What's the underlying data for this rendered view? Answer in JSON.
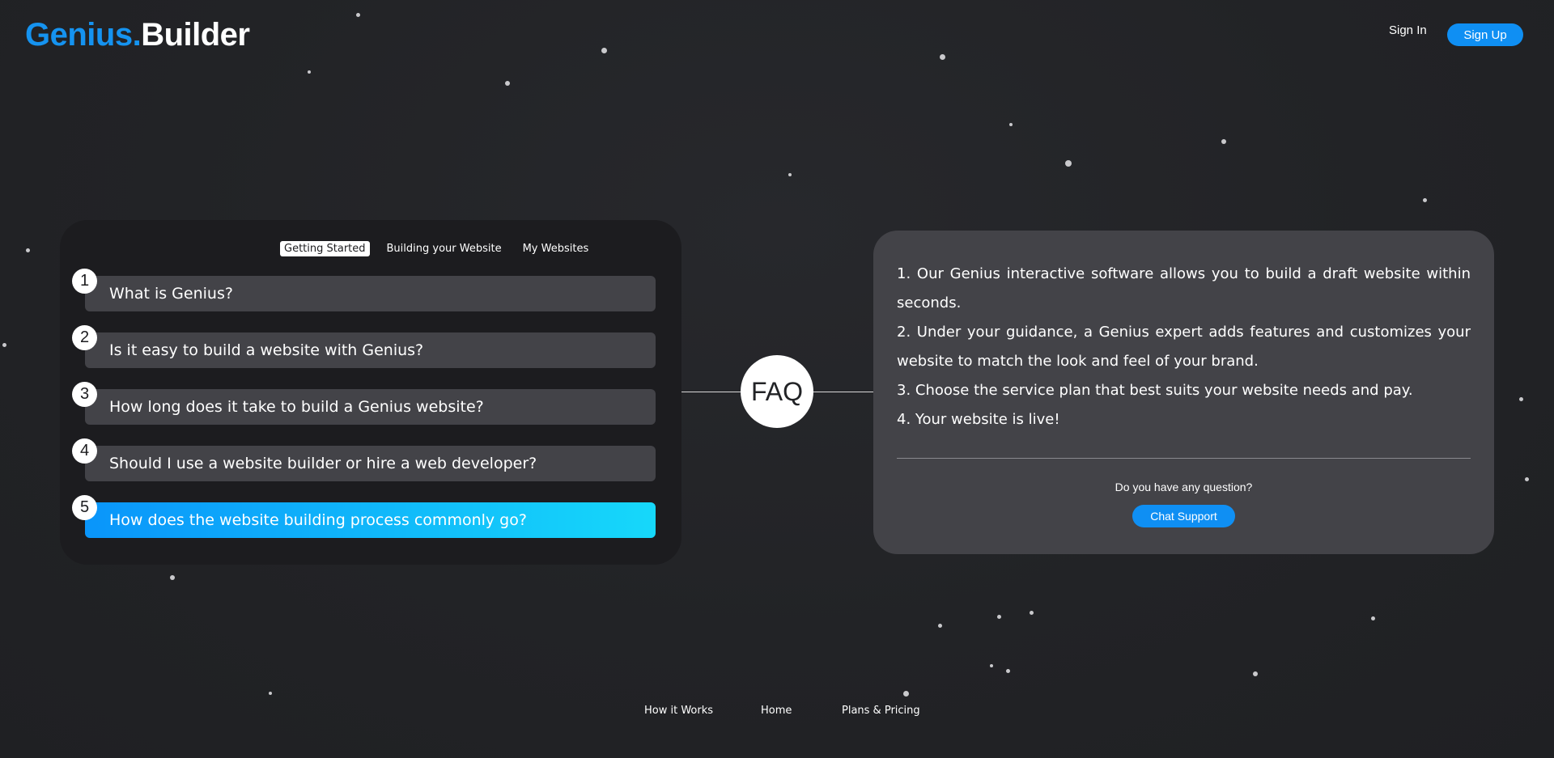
{
  "header": {
    "logo_part1": "Genius.",
    "logo_part2": "Builder",
    "sign_in": "Sign In",
    "sign_up": "Sign Up"
  },
  "faq": {
    "tabs": [
      {
        "label": "Getting Started",
        "active": true
      },
      {
        "label": "Building your Website",
        "active": false
      },
      {
        "label": "My Websites",
        "active": false
      }
    ],
    "questions": [
      {
        "number": "1",
        "text": "What is Genius?",
        "active": false
      },
      {
        "number": "2",
        "text": "Is it easy to build a website with Genius?",
        "active": false
      },
      {
        "number": "3",
        "text": "How long does it take to build a Genius website?",
        "active": false
      },
      {
        "number": "4",
        "text": "Should I use a website builder or hire a web developer?",
        "active": false
      },
      {
        "number": "5",
        "text": "How does the website building process commonly go?",
        "active": true
      }
    ],
    "center_label": "FAQ",
    "answer_lines": [
      "1. Our Genius interactive software allows you to build a draft website within seconds.",
      "2. Under your guidance, a Genius expert adds features and customizes your website to match the look and feel of your brand.",
      "3. Choose the service plan that best suits your website needs and pay.",
      "4. Your website is live!"
    ],
    "question_prompt": "Do you have any question?",
    "chat_support": "Chat Support"
  },
  "footer": {
    "links": [
      "How it Works",
      "Home",
      "Plans & Pricing"
    ]
  },
  "colors": {
    "accent": "#0f8ff3",
    "active_gradient_start": "#0a95fa",
    "active_gradient_end": "#16d8fa",
    "background": "#222326"
  }
}
